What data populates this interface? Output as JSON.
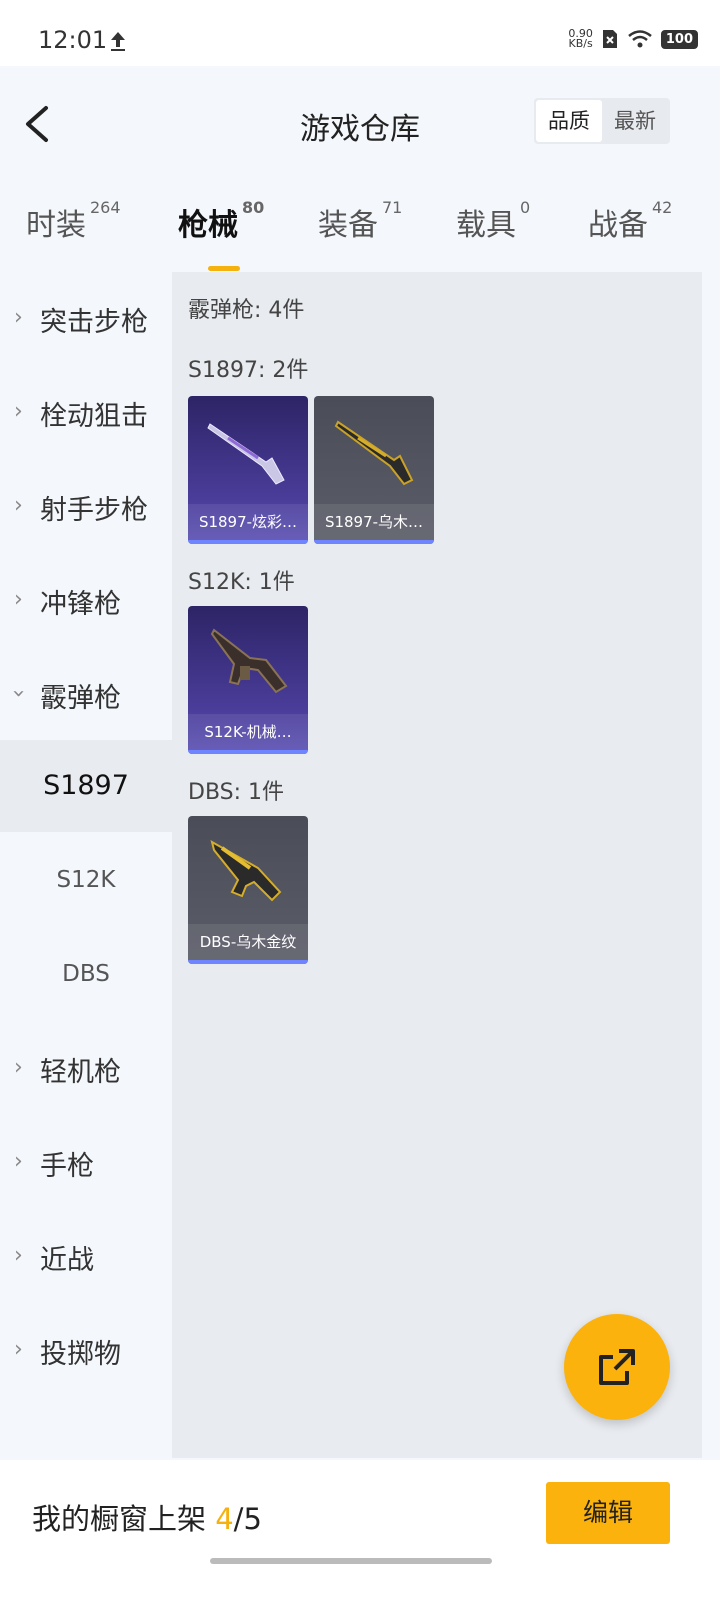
{
  "status": {
    "time": "12:01",
    "netspeed_value": "0.90",
    "netspeed_unit": "KB/s",
    "battery": "100",
    "icons": [
      "upload-icon",
      "sim-off-icon",
      "wifi-icon",
      "battery-icon"
    ]
  },
  "header": {
    "title": "游戏仓库",
    "sort_quality": "品质",
    "sort_newest": "最新"
  },
  "tabs": [
    {
      "label": "时装",
      "count": "264"
    },
    {
      "label": "枪械",
      "count": "80"
    },
    {
      "label": "装备",
      "count": "71"
    },
    {
      "label": "载具",
      "count": "0"
    },
    {
      "label": "战备",
      "count": "42"
    }
  ],
  "sidebar": {
    "items": [
      "突击步枪",
      "栓动狙击",
      "射手步枪",
      "冲锋枪",
      "霰弹枪",
      "轻机枪",
      "手枪",
      "近战",
      "投掷物"
    ],
    "subitems": [
      "S1897",
      "S12K",
      "DBS"
    ]
  },
  "content": {
    "summary": "霰弹枪: 4件",
    "groups": [
      {
        "title": "S1897: 2件",
        "items": [
          "S1897-炫彩…",
          "S1897-乌木…"
        ]
      },
      {
        "title": "S12K: 1件",
        "items": [
          "S12K-机械…"
        ]
      },
      {
        "title": "DBS: 1件",
        "items": [
          "DBS-乌木金纹"
        ]
      }
    ]
  },
  "footer": {
    "prefix": "我的橱窗上架 ",
    "current": "4",
    "sep_total": "/5",
    "edit": "编辑"
  },
  "colors": {
    "accent": "#fbb20c",
    "card_purple": "#3a2f80",
    "card_gray": "#53555f",
    "card_bar": "#6e85ff"
  }
}
